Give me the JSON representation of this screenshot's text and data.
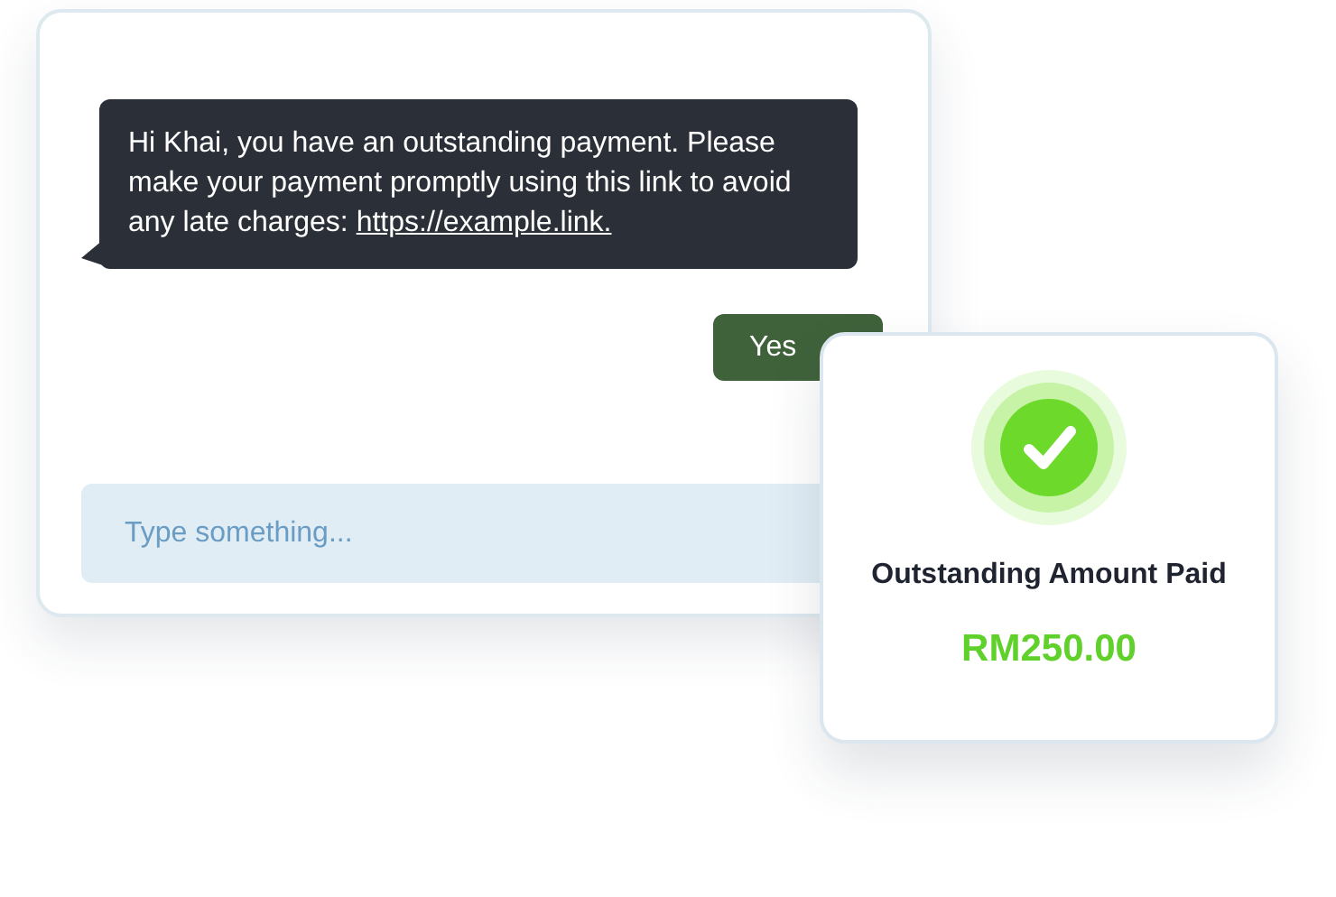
{
  "chat": {
    "message": {
      "text": "Hi Khai, you have an outstanding payment. Please make your payment promptly using this link to avoid any late charges:",
      "link": "https://example.link."
    },
    "reply": "Yes",
    "input": {
      "placeholder": "Type something..."
    }
  },
  "receipt": {
    "paid": true,
    "title": "Outstanding Amount Paid",
    "amount": "RM250.00"
  }
}
